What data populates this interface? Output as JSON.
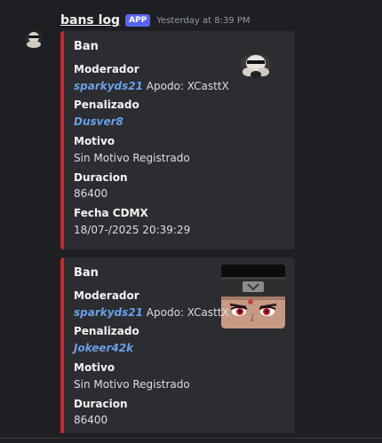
{
  "message": {
    "author": "bans log",
    "badge": "APP",
    "timestamp": "Yesterday at 8:39 PM"
  },
  "embeds": [
    {
      "title": "Ban",
      "accent_color": "#d2232a",
      "fields": [
        {
          "name": "Moderador",
          "mention": "sparkyds21",
          "value": " Apodo: XCasttX"
        },
        {
          "name": "Penalizado",
          "mention": "Dusver8",
          "value": ""
        },
        {
          "name": "Motivo",
          "mention": "",
          "value": "Sin Motivo Registrado"
        },
        {
          "name": "Duracion",
          "mention": "",
          "value": "86400"
        },
        {
          "name": "Fecha CDMX",
          "mention": "",
          "value": "18/07-/2025 20:39:29"
        }
      ],
      "thumbnail_icon": "masked-character-thumbnail-icon"
    },
    {
      "title": "Ban",
      "accent_color": "#d2232a",
      "fields": [
        {
          "name": "Moderador",
          "mention": "sparkyds21",
          "value": " Apodo: XCasttX"
        },
        {
          "name": "Penalizado",
          "mention": "Jokeer42k",
          "value": ""
        },
        {
          "name": "Motivo",
          "mention": "",
          "value": "Sin Motivo Registrado"
        },
        {
          "name": "Duracion",
          "mention": "",
          "value": "86400"
        }
      ],
      "thumbnail_icon": "anime-face-headband-thumbnail-icon"
    }
  ],
  "colors": {
    "background": "#1e1f22",
    "embed_bg": "#2b2d31",
    "mention": "#6a9fe6",
    "badge": "#5865f2"
  }
}
